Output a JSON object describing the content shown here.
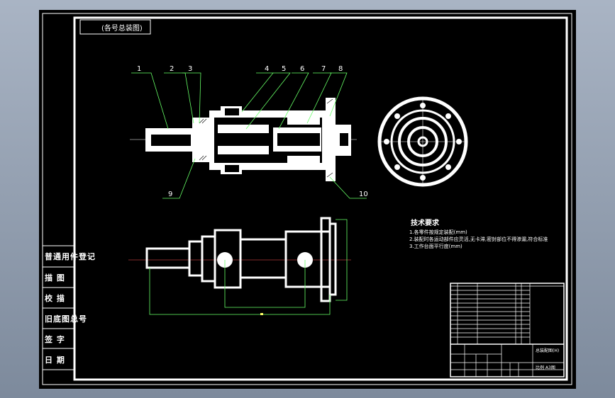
{
  "title_tab": "(各号总装图)",
  "balloons": [
    "1",
    "2",
    "3",
    "4",
    "5",
    "6",
    "7",
    "8",
    "9",
    "10"
  ],
  "side_labels": [
    "普通用件登记",
    "描 图",
    "校 描",
    "旧底图总号",
    "签 字",
    "日 期"
  ],
  "tech_requirements": {
    "heading": "技术要求",
    "lines": [
      "1.各零件按规定装配(mm)",
      "2.装配时各运动部件应灵活,无卡滞,密封部位不得渗漏,符合标准",
      "3.工作台面平行度(mm)"
    ]
  },
  "title_block": {
    "drawing_name": "总装配图(H)",
    "scale_label": "比例 A3图"
  },
  "colors": {
    "background": "#000000",
    "frame": "#ffffff",
    "dimension": "#ffff66",
    "leader": "#66ff66",
    "center": "#ff5555",
    "sheet_bg": "#9aa6b6"
  }
}
